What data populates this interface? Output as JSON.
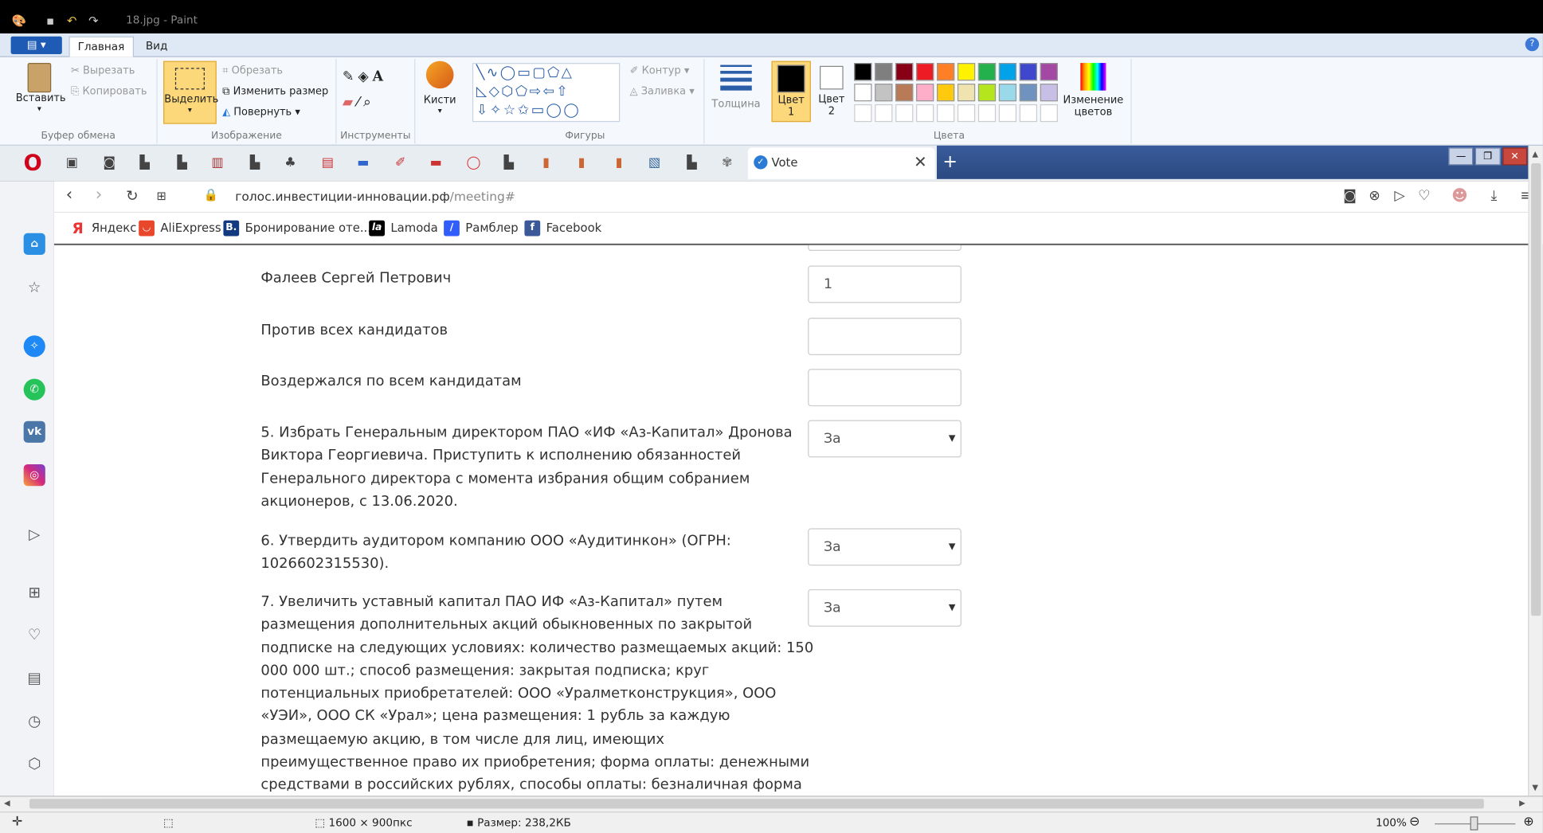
{
  "window": {
    "title": "18.jpg - Paint"
  },
  "ribbon": {
    "file_menu": "▤ ▾",
    "tabs": [
      "Главная",
      "Вид"
    ],
    "clipboard": {
      "paste": "Вставить",
      "cut": "Вырезать",
      "copy": "Копировать",
      "group": "Буфер обмена"
    },
    "image": {
      "select": "Выделить",
      "crop": "Обрезать",
      "resize": "Изменить размер",
      "rotate": "Повернуть",
      "group": "Изображение"
    },
    "tools": {
      "group": "Инструменты",
      "brushes": "Кисти"
    },
    "shapes": {
      "outline": "Контур",
      "fill": "Заливка",
      "group": "Фигуры"
    },
    "size": "Толщина",
    "colors": {
      "color1": "Цвет",
      "color1_n": "1",
      "color2": "Цвет",
      "color2_n": "2",
      "edit": "Изменение",
      "edit2": "цветов",
      "group": "Цвета",
      "palette_row1": [
        "#000000",
        "#7f7f7f",
        "#880015",
        "#ed1c24",
        "#ff7f27",
        "#fff200",
        "#22b14c",
        "#00a2e8",
        "#3f48cc",
        "#a349a4"
      ],
      "palette_row2": [
        "#ffffff",
        "#c3c3c3",
        "#b97a57",
        "#ffaec9",
        "#ffc90e",
        "#efe4b0",
        "#b5e61d",
        "#99d9ea",
        "#7092be",
        "#c8bfe7"
      ]
    }
  },
  "browser": {
    "active_tab": "Vote",
    "url_host": "голос.инвестиции-инновации.рф",
    "url_path": "/meeting#",
    "bookmarks": [
      "Яндекс",
      "AliExpress",
      "Бронирование оте...",
      "Lamoda",
      "Рамблер",
      "Facebook"
    ]
  },
  "form": {
    "rows": [
      {
        "label": "Фалеев Сергей Петрович",
        "value": "1"
      },
      {
        "label": "Против всех кандидатов",
        "value": ""
      },
      {
        "label": "Воздержался по всем кандидатам",
        "value": ""
      }
    ],
    "q5": {
      "lines": [
        "5. Избрать Генеральным директором ПАО «ИФ «Аз-Капитал» Дронова",
        "Виктора Георгиевича. Приступить к исполнению обязанностей",
        "Генерального директора с момента избрания общим собранием",
        "акционеров, с 13.06.2020."
      ],
      "choice": "За"
    },
    "q6": {
      "lines": [
        "6. Утвердить аудитором компанию ООО «Аудитинкон» (ОГРН:",
        "1026602315530)."
      ],
      "choice": "За"
    },
    "q7": {
      "lines": [
        "7. Увеличить уставный капитал ПАО ИФ «Аз-Капитал» путем",
        "размещения дополнительных акций обыкновенных по закрытой",
        "подписке на следующих условиях: количество размещаемых акций: 150",
        "000 000 шт.; способ размещения: закрытая подписка; круг",
        "потенциальных приобретателей: ООО «Уралметконструкция», ООО",
        "«УЭИ», ООО СК «Урал»; цена размещения: 1 рубль за каждую",
        "размещаемую акцию, в том числе для лиц, имеющих",
        "преимущественное право их приобретения; форма оплаты: денежными",
        "средствами в российских рублях, способы оплаты: безналичная форма"
      ],
      "choice": "За"
    }
  },
  "status": {
    "dimensions": "1600 × 900пкс",
    "size": "Размер: 238,2КБ",
    "zoom": "100%"
  }
}
